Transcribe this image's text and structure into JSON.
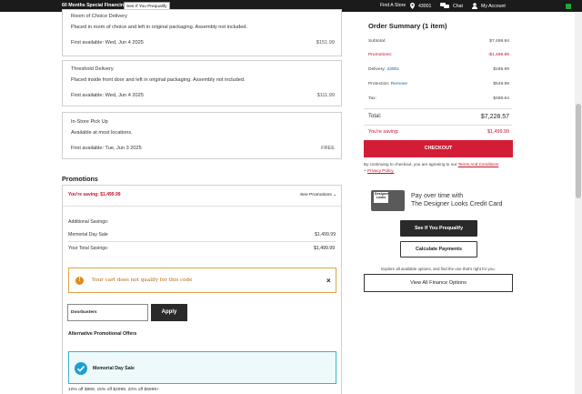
{
  "topbar": {
    "promo": "60 Months Special Financing*",
    "prequal": "See If You Prequalify",
    "find_store": "Find A Store",
    "zip": "43001",
    "chat": "Chat",
    "account": "My Account"
  },
  "delivery_options": [
    {
      "title": "Room of Choice Delivery",
      "desc": "Placed in room of choice and left in original packaging. Assembly not included.",
      "first_available": "First available: Wed, Jun 4 2025",
      "price": "$151.99"
    },
    {
      "title": "Threshold Delivery",
      "desc": "Placed inside front door and left in original packaging. Assembly not included.",
      "first_available": "First available: Wed, Jun 4 2025",
      "price": "$111.99"
    },
    {
      "title": "In-Store Pick Up",
      "desc": "Available at most locations.",
      "first_available": "First available: Tue, Jun 3 2025",
      "price": "FREE"
    }
  ],
  "promotions": {
    "heading": "Promotions",
    "saving": "You're saving: $1,499.99",
    "see_promotions": "See Promotions",
    "additional_label": "Additional Savings:",
    "sale_label": "Memorial Day Sale",
    "sale_value": "$1,499.99",
    "total_label": "Your Total Savings:",
    "total_value": "$1,499.99",
    "warning": "Your cart does not qualify for this code",
    "code_value": "Doorbusters",
    "apply": "Apply",
    "alt_heading": "Alternative Promotional Offers",
    "alt_offer": "Memorial Day Sale",
    "alt_terms": "10% off $999, 15% off $2999, 20% off $5999+"
  },
  "summary": {
    "heading": "Order Summary (1 item)",
    "subtotal_label": "Subtotal:",
    "subtotal": "$7,499.94",
    "promotions_label": "Promotions:",
    "promotions": "-$1,499.99",
    "delivery_label": "Delivery:",
    "delivery_zip": "43001",
    "delivery": "$189.99",
    "protection_label": "Protection:",
    "protection_remove": "Remove",
    "protection": "$549.99",
    "tax_label": "Tax:",
    "tax": "$488.64",
    "total_label": "Total:",
    "total": "$7,228.57",
    "saving_label": "You're saving:",
    "saving": "$1,499.99",
    "checkout": "CHECKOUT",
    "legal_prefix": "By continuing to checkout, you are agreeing to our",
    "terms": "Terms And Conditions",
    "legal_join": "+",
    "privacy": "Privacy Policy."
  },
  "finance": {
    "logo_l1": "Designer",
    "logo_l2": "Looks",
    "pay_l1": "Pay over time with",
    "pay_l2": "The Designer Looks Credit Card",
    "prequal": "See If You Prequalify",
    "calculate": "Calculate Payments",
    "explore": "Explore all available options, and find the one that's right for you.",
    "view_all": "View All Finance Options"
  }
}
